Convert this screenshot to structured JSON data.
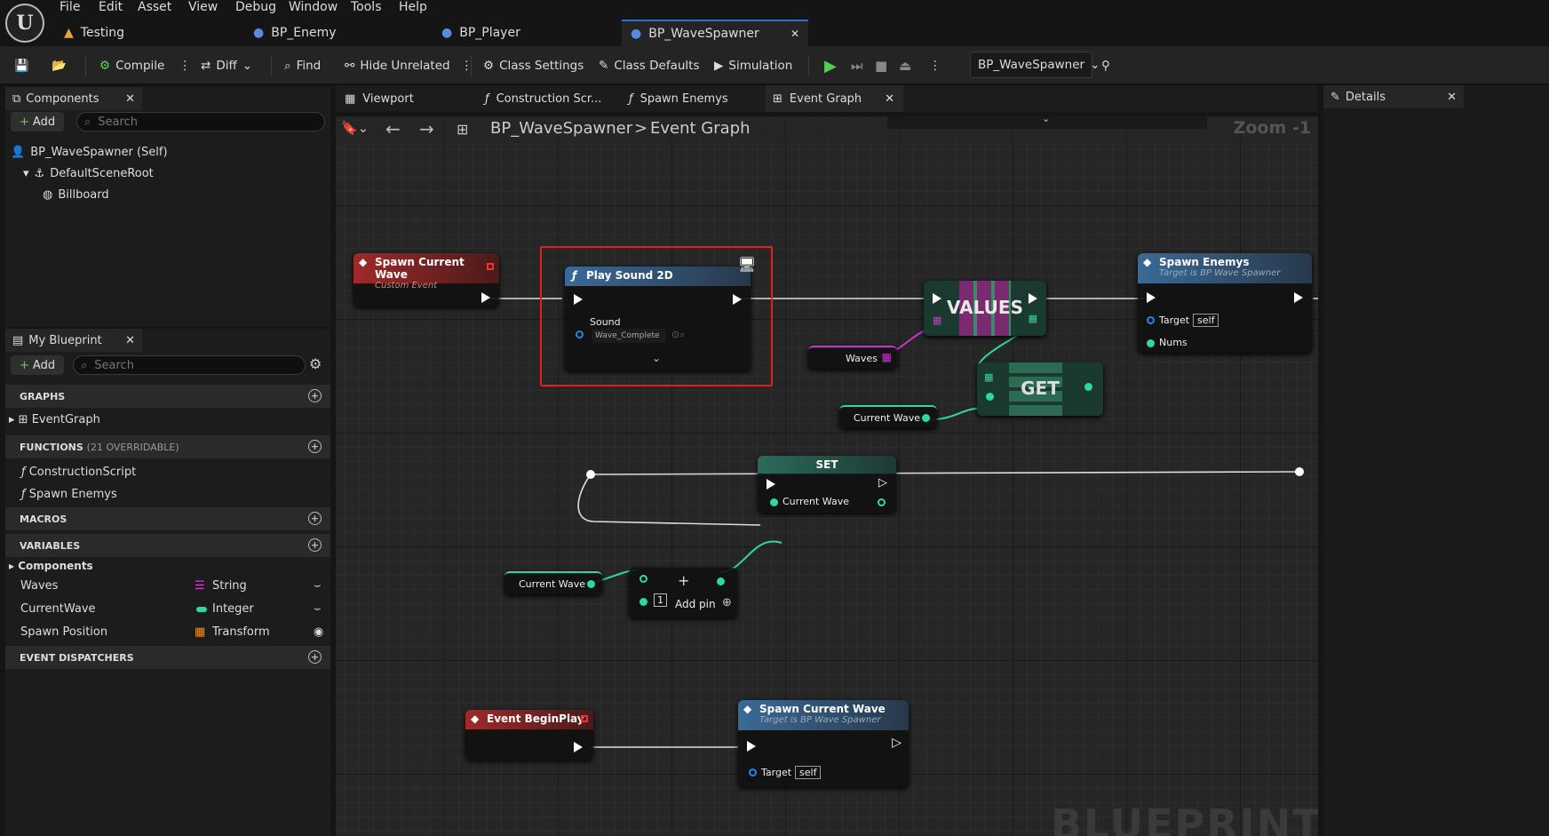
{
  "menu": [
    "File",
    "Edit",
    "Asset",
    "View",
    "Debug",
    "Window",
    "Tools",
    "Help"
  ],
  "doc_tabs": [
    "Testing",
    "BP_Enemy",
    "BP_Player",
    "BP_WaveSpawner"
  ],
  "toolbar": {
    "compile": "Compile",
    "diff": "Diff",
    "find": "Find",
    "hide_unrelated": "Hide Unrelated",
    "class_settings": "Class Settings",
    "class_defaults": "Class Defaults",
    "simulation": "Simulation",
    "debug_object": "BP_WaveSpawner"
  },
  "components": {
    "tab": "Components",
    "add": "Add",
    "search_placeholder": "Search",
    "tree": [
      "BP_WaveSpawner (Self)",
      "DefaultSceneRoot",
      "Billboard"
    ]
  },
  "myblueprint": {
    "tab": "My Blueprint",
    "add": "Add",
    "search_placeholder": "Search",
    "graphs_label": "GRAPHS",
    "event_graph": "EventGraph",
    "functions_label": "FUNCTIONS",
    "functions_count": "(21 OVERRIDABLE)",
    "functions": [
      "ConstructionScript",
      "Spawn Enemys"
    ],
    "macros_label": "MACROS",
    "variables_label": "VARIABLES",
    "components_cat": "Components",
    "variables": [
      {
        "name": "Waves",
        "type": "String"
      },
      {
        "name": "CurrentWave",
        "type": "Integer"
      },
      {
        "name": "Spawn Position",
        "type": "Transform"
      }
    ],
    "dispatchers_label": "EVENT DISPATCHERS"
  },
  "graph_tabs": [
    "Viewport",
    "Construction Scr...",
    "Spawn Enemys",
    "Event Graph"
  ],
  "breadcrumb": {
    "root": "BP_WaveSpawner",
    "sep": ">",
    "current": "Event Graph",
    "zoom": "Zoom -1"
  },
  "details": {
    "tab": "Details"
  },
  "nodes": {
    "spawn_current_wave_event": {
      "title": "Spawn Current Wave",
      "subtitle": "Custom Event"
    },
    "play_sound": {
      "title": "Play Sound 2D",
      "sound_label": "Sound",
      "sound_value": "Wave_Complete"
    },
    "values": "VALUES",
    "get": "GET",
    "waves_var": "Waves",
    "current_wave_var": "Current Wave",
    "current_wave_var2": "Current Wave",
    "spawn_enemys": {
      "title": "Spawn Enemys",
      "subtitle": "Target is BP Wave Spawner",
      "target": "Target",
      "self": "self",
      "nums": "Nums"
    },
    "set": {
      "title": "SET",
      "pin": "Current Wave"
    },
    "add": {
      "add_pin": "Add pin",
      "literal": "1"
    },
    "begin_play": {
      "title": "Event BeginPlay"
    },
    "spawn_call": {
      "title": "Spawn Current Wave",
      "subtitle": "Target is BP Wave Spawner",
      "target": "Target",
      "self": "self"
    },
    "watermark": "BLUEPRINT"
  }
}
